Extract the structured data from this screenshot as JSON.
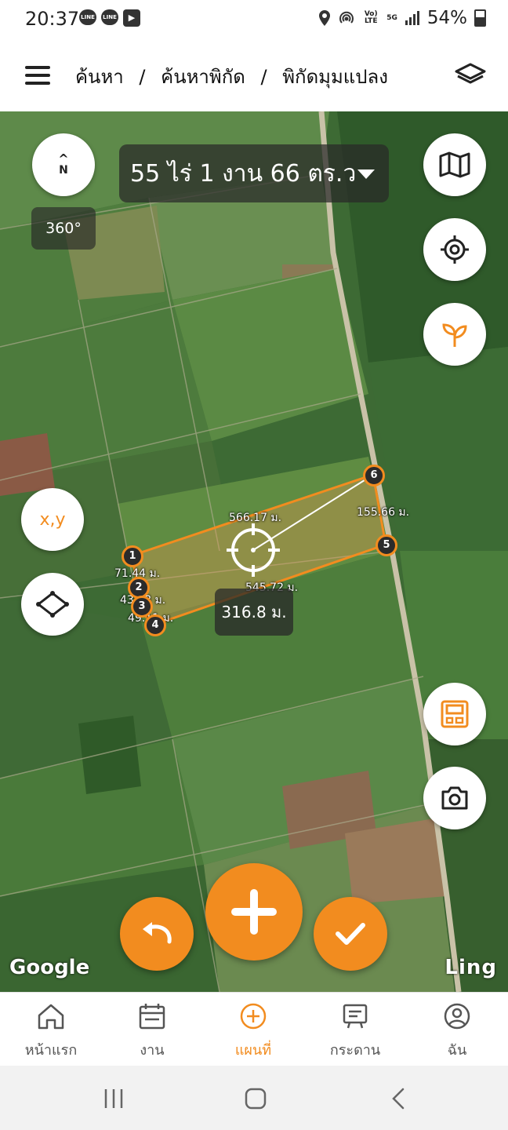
{
  "status_bar": {
    "time": "20:37",
    "notifications": [
      "LINE",
      "LINE",
      "play"
    ],
    "network_volte": "Vo) LTE",
    "network_5g": "5G",
    "battery": "54%"
  },
  "app_bar": {
    "menu_icon": "hamburger-icon",
    "breadcrumb": [
      "ค้นหา",
      "ค้นหาพิกัด",
      "พิกัดมุมแปลง"
    ],
    "separator": "/",
    "layers_icon": "layers-icon"
  },
  "map": {
    "area_text": "55 ไร่ 1 งาน 66 ตร.ว",
    "compass_label": "N",
    "rotation": "360°",
    "coord_button": "x,y",
    "segments": [
      {
        "label": "566.17 ม."
      },
      {
        "label": "155.66 ม."
      },
      {
        "label": "545.72 ม."
      },
      {
        "label": "71.44 ม."
      },
      {
        "label": "43.18 ม."
      },
      {
        "label": "49.11 ม."
      }
    ],
    "vertices": [
      "1",
      "2",
      "3",
      "4",
      "5",
      "6"
    ],
    "current_distance": "316.8 ม.",
    "attribution_left": "Google",
    "attribution_right": "Ling",
    "accent_color": "#f28c1f"
  },
  "bottom_nav": {
    "items": [
      {
        "label": "หน้าแรก",
        "icon": "home-icon"
      },
      {
        "label": "งาน",
        "icon": "calendar-icon"
      },
      {
        "label": "แผนที่",
        "icon": "add-circle-icon",
        "active": true
      },
      {
        "label": "กระดาน",
        "icon": "board-icon"
      },
      {
        "label": "ฉัน",
        "icon": "profile-icon"
      }
    ]
  },
  "system_nav": [
    "recent-apps-icon",
    "home-icon",
    "back-icon"
  ]
}
